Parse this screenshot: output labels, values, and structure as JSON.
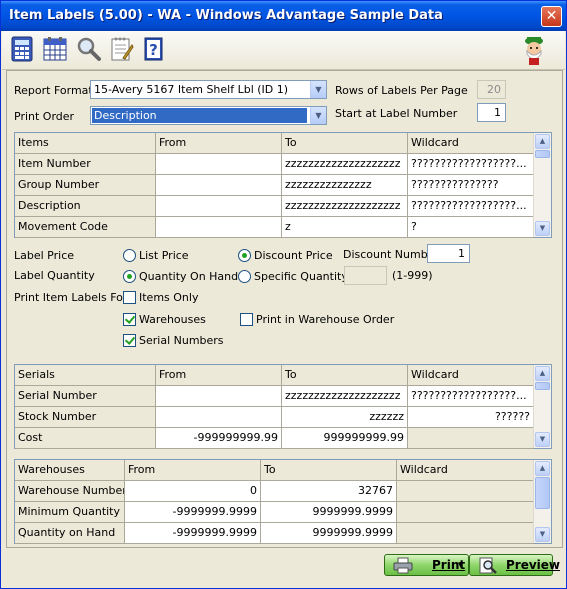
{
  "window": {
    "title": "Item Labels (5.00) - WA - Windows Advantage Sample Data",
    "close": "✕"
  },
  "toolbar": {
    "icons": [
      "calculator-icon",
      "calendar-icon",
      "magnifier-icon",
      "notepad-icon",
      "help-icon",
      "mascot-icon"
    ]
  },
  "form": {
    "report_format_label": "Report Format",
    "report_format_value": "15-Avery 5167 Item Shelf Lbl (ID 1)",
    "print_order_label": "Print Order",
    "print_order_value": "Description",
    "rows_label": "Rows of Labels Per Page",
    "rows_value": "20",
    "start_label": "Start at Label Number",
    "start_value": "1"
  },
  "items_grid": {
    "headers": [
      "Items",
      "From",
      "To",
      "Wildcard"
    ],
    "rows": [
      [
        "Item Number",
        "",
        "zzzzzzzzzzzzzzzzzzzz",
        "??????????????????..."
      ],
      [
        "Group Number",
        "",
        "zzzzzzzzzzzzzzz",
        "???????????????"
      ],
      [
        "Description",
        "",
        "zzzzzzzzzzzzzzzzzzzz",
        "??????????????????..."
      ],
      [
        "Movement Code",
        "",
        "z",
        "?"
      ]
    ]
  },
  "options": {
    "label_price_label": "Label Price",
    "list_price": "List Price",
    "discount_price": "Discount Price",
    "discount_number_label": "Discount Number",
    "discount_number_value": "1",
    "label_quantity_label": "Label Quantity",
    "quantity_on_hand": "Quantity On Hand",
    "specific_quantity": "Specific Quantity",
    "specific_quantity_value": "",
    "range_hint": "(1-999)",
    "print_for_label": "Print Item Labels For",
    "items_only": "Items Only",
    "warehouses": "Warehouses",
    "print_in_warehouse_order": "Print in Warehouse Order",
    "serial_numbers": "Serial Numbers"
  },
  "serials_grid": {
    "headers": [
      "Serials",
      "From",
      "To",
      "Wildcard"
    ],
    "rows": [
      [
        "Serial Number",
        "",
        "zzzzzzzzzzzzzzzzzzzz",
        "??????????????????..."
      ],
      [
        "Stock Number",
        "",
        "zzzzzz",
        "??????"
      ],
      [
        "Cost",
        "-999999999.99",
        "999999999.99",
        ""
      ]
    ]
  },
  "warehouses_grid": {
    "headers": [
      "Warehouses",
      "From",
      "To",
      "Wildcard"
    ],
    "rows": [
      [
        "Warehouse Number",
        "0",
        "32767",
        ""
      ],
      [
        "Minimum Quantity",
        "-9999999.9999",
        "9999999.9999",
        ""
      ],
      [
        "Quantity on Hand",
        "-9999999.9999",
        "9999999.9999",
        ""
      ]
    ]
  },
  "buttons": {
    "print": "Print",
    "preview": "Preview"
  },
  "colors": {
    "title_bar": "#0055e5",
    "selection": "#316ac5",
    "green_button": "#8fd66b"
  }
}
